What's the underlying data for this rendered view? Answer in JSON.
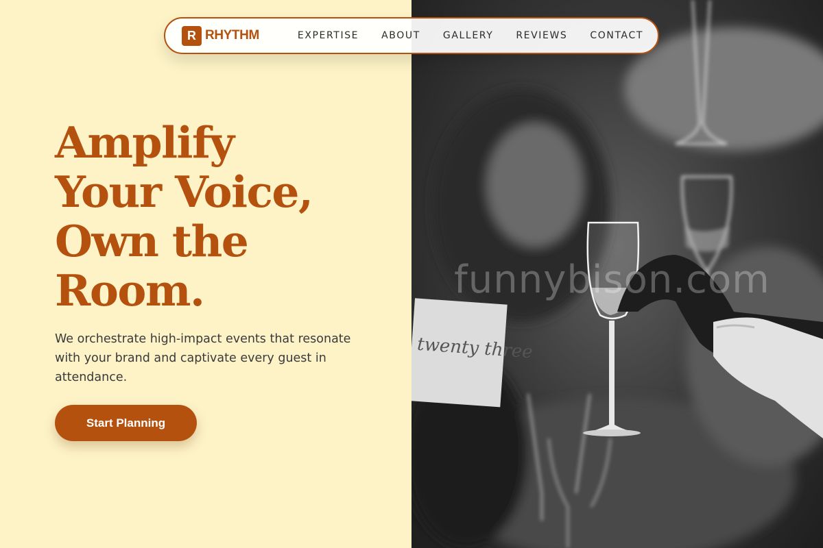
{
  "brand": {
    "logo_letter": "R",
    "name": "RHYTHM"
  },
  "nav": {
    "items": [
      "EXPERTISE",
      "ABOUT",
      "GALLERY",
      "REVIEWS",
      "CONTACT"
    ]
  },
  "hero": {
    "title_lines": [
      "Amplify",
      "Your Voice,",
      "Own the",
      "Room."
    ],
    "subtitle": "We orchestrate high-impact events that resonate with your brand and captivate every guest in attendance.",
    "cta_label": "Start Planning"
  },
  "photo": {
    "watermark": "funnybison.com",
    "card_text": "twenty three"
  },
  "colors": {
    "accent": "#b5510e",
    "background": "#fdf3c7",
    "text": "#3a3a3a"
  }
}
